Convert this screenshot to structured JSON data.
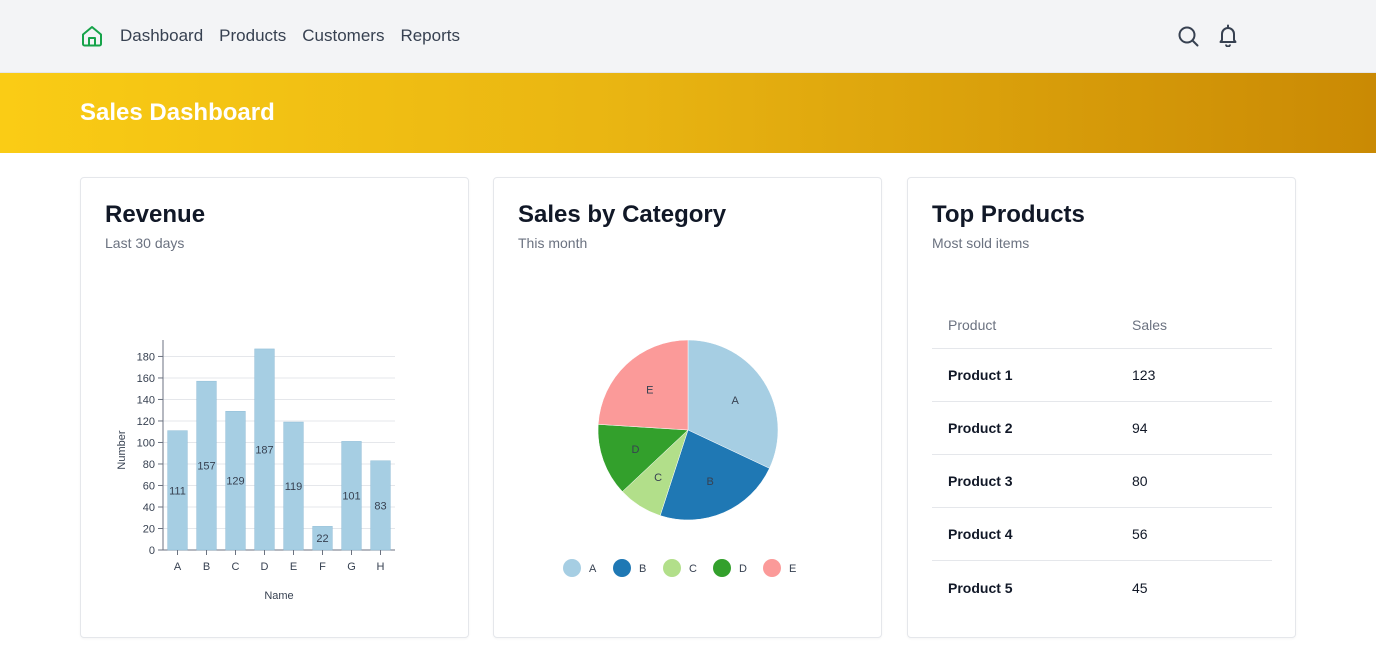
{
  "nav": {
    "home_icon": "home-icon",
    "links": [
      "Dashboard",
      "Products",
      "Customers",
      "Reports"
    ],
    "search_icon": "search-icon",
    "notification_icon": "bell-icon"
  },
  "hero": {
    "title": "Sales Dashboard"
  },
  "cards": {
    "revenue": {
      "title": "Revenue",
      "subtitle": "Last 30 days"
    },
    "category": {
      "title": "Sales by Category",
      "subtitle": "This month"
    },
    "top_products": {
      "title": "Top Products",
      "subtitle": "Most sold items",
      "columns": [
        "Product",
        "Sales"
      ],
      "rows": [
        {
          "name": "Product 1",
          "sales": "123"
        },
        {
          "name": "Product 2",
          "sales": "94"
        },
        {
          "name": "Product 3",
          "sales": "80"
        },
        {
          "name": "Product 4",
          "sales": "56"
        },
        {
          "name": "Product 5",
          "sales": "45"
        }
      ]
    }
  },
  "colors": {
    "accent": "#16a34a",
    "bar": "#a6cee3",
    "grid": "#e5e7eb",
    "pie": [
      "#a6cee3",
      "#1f78b4",
      "#b2df8a",
      "#33a02c",
      "#fb9a99"
    ]
  },
  "chart_data": [
    {
      "type": "bar",
      "categories": [
        "A",
        "B",
        "C",
        "D",
        "E",
        "F",
        "G",
        "H"
      ],
      "values": [
        111,
        157,
        129,
        187,
        119,
        22,
        101,
        83
      ],
      "xlabel": "Name",
      "ylabel": "Number",
      "ylim": [
        0,
        180
      ],
      "yticks": [
        0,
        20,
        40,
        60,
        80,
        100,
        120,
        140,
        160,
        180
      ],
      "grid": true,
      "data_labels": true
    },
    {
      "type": "pie",
      "categories": [
        "A",
        "B",
        "C",
        "D",
        "E"
      ],
      "values": [
        32,
        23,
        8,
        13,
        24
      ],
      "legend": "bottom",
      "slice_labels": true
    }
  ]
}
